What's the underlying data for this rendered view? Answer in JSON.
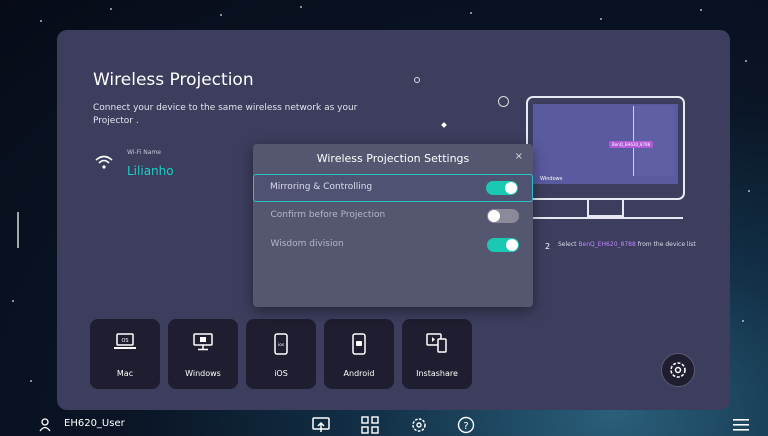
{
  "title": "Wireless Projection",
  "subtitle": "Connect your device to the same wireless network as your Projector .",
  "wifi": {
    "label": "Wi-Fi Name",
    "name": "Lilianho"
  },
  "illustration": {
    "device_label": "BenQ_EH620_8788",
    "window_label": "Windows",
    "step_number": "2",
    "step_prefix": "Select ",
    "step_device": "BenQ_EH620_8788",
    "step_suffix": " from the device list"
  },
  "dialog": {
    "title": "Wireless Projection Settings",
    "close": "×",
    "options": [
      {
        "label": "Mirroring & Controlling",
        "on": true
      },
      {
        "label": "Confirm before Projection",
        "on": false
      },
      {
        "label": "Wisdom division",
        "on": true
      }
    ]
  },
  "tiles": [
    {
      "label": "Mac",
      "icon": "mac-laptop-icon",
      "sub": "OS"
    },
    {
      "label": "Windows",
      "icon": "windows-monitor-icon"
    },
    {
      "label": "iOS",
      "icon": "ios-phone-icon",
      "sub": "ios"
    },
    {
      "label": "Android",
      "icon": "android-phone-icon"
    },
    {
      "label": "Instashare",
      "icon": "instashare-icon"
    }
  ],
  "bottom": {
    "user": "EH620_User"
  },
  "colors": {
    "panel": "#3d3d5e",
    "accent": "#1bc8b2",
    "tile": "#1e1e30"
  }
}
